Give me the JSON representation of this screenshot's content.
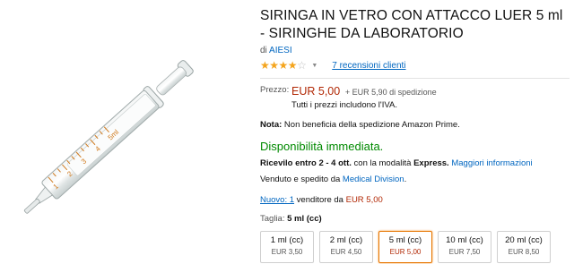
{
  "product": {
    "title": "SIRINGA IN VETRO CON ATTACCO LUER 5 ml - SIRINGHE DA LABORATORIO",
    "by_prefix": "di",
    "brand": "AIESI",
    "rating": 3.5,
    "reviews_link": "7 recensioni clienti"
  },
  "price": {
    "label": "Prezzo:",
    "value": "EUR 5,00",
    "shipping": "+ EUR 5,90 di spedizione",
    "vat": "Tutti i prezzi includono l'IVA."
  },
  "note": {
    "label": "Nota:",
    "text": "Non beneficia della spedizione Amazon Prime."
  },
  "availability": "Disponibilità immediata.",
  "delivery": {
    "bold": "Ricevilo entro 2 - 4 ott.",
    "middle": "con la modalità",
    "mode": "Express.",
    "link": "Maggiori informazioni"
  },
  "seller": {
    "prefix": "Venduto e spedito da",
    "name": "Medical Division",
    "suffix": "."
  },
  "offers": {
    "link": "Nuovo: 1",
    "middle": "venditore da",
    "price": "EUR 5,00"
  },
  "size": {
    "label": "Taglia:",
    "selected": "5 ml (cc)",
    "options": [
      {
        "name": "1 ml (cc)",
        "price": "EUR 3,50"
      },
      {
        "name": "2 ml (cc)",
        "price": "EUR 4,50"
      },
      {
        "name": "5 ml (cc)",
        "price": "EUR 5,00"
      },
      {
        "name": "10 ml (cc)",
        "price": "EUR 7,50"
      },
      {
        "name": "20 ml (cc)",
        "price": "EUR 8,50"
      }
    ]
  },
  "image": {
    "scale_labels": [
      "1",
      "2",
      "3",
      "4",
      "5ml"
    ]
  },
  "colors": {
    "link": "#0066c0",
    "price": "#b12704",
    "availability": "#008a00",
    "selected_border": "#e77600",
    "star": "#f4a41c"
  }
}
